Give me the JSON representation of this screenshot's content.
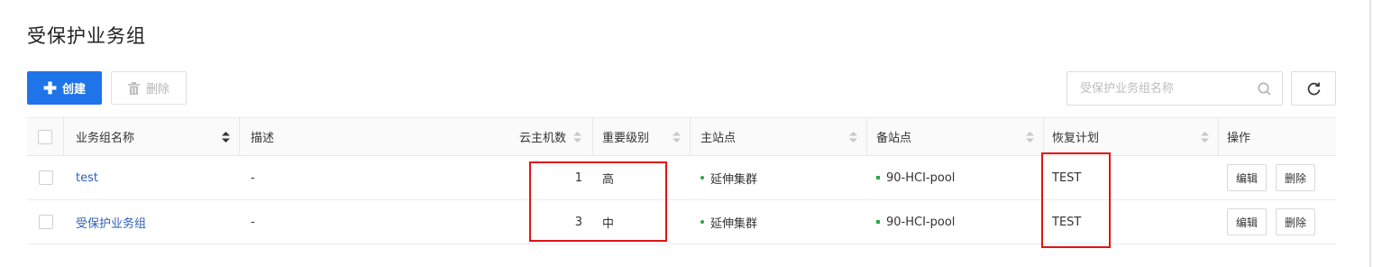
{
  "page": {
    "title": "受保护业务组"
  },
  "toolbar": {
    "create_label": "创建",
    "delete_label": "删除"
  },
  "search": {
    "placeholder": "受保护业务组名称",
    "value": ""
  },
  "table": {
    "columns": {
      "name": "业务组名称",
      "desc": "描述",
      "vm_count": "云主机数",
      "level": "重要级别",
      "main_site": "主站点",
      "backup_site": "备站点",
      "plan": "恢复计划",
      "ops": "操作"
    },
    "rows": [
      {
        "name": "test",
        "desc": "-",
        "vm_count": "1",
        "level": "高",
        "main_site": "延伸集群",
        "backup_site": "90-HCI-pool",
        "plan": "TEST",
        "edit": "编辑",
        "delete": "删除"
      },
      {
        "name": "受保护业务组",
        "desc": "-",
        "vm_count": "3",
        "level": "中",
        "main_site": "延伸集群",
        "backup_site": "90-HCI-pool",
        "plan": "TEST",
        "edit": "编辑",
        "delete": "删除"
      }
    ]
  },
  "colors": {
    "primary": "#1e74e8",
    "link": "#2e5fbb",
    "status_dot": "#2ba748",
    "highlight": "#e01414"
  },
  "icons": [
    "plus-icon",
    "trash-icon",
    "search-icon",
    "refresh-icon",
    "sort-icon"
  ]
}
